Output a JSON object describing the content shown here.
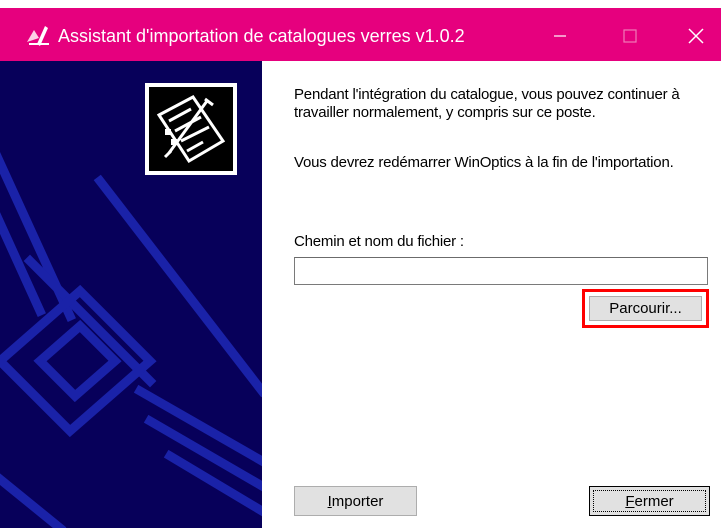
{
  "window": {
    "title": "Assistant d'importation de catalogues verres v1.0.2",
    "title_bar_color": "#e6007e",
    "controls": [
      "minimize-icon",
      "maximize-icon",
      "close-icon"
    ]
  },
  "sidebar": {
    "background_color": "#07005a",
    "emblem_icon": "document-pen-icon"
  },
  "content": {
    "paragraph1": "Pendant l'intégration du catalogue, vous pouvez continuer à travailler normalement, y compris sur ce poste.",
    "paragraph2": "Vous devrez redémarrer WinOptics à la fin de l'importation.",
    "file_label": "Chemin et nom du fichier :",
    "file_value": ""
  },
  "buttons": {
    "browse": "Parcourir...",
    "import_first": "I",
    "import_rest": "mporter",
    "close_first": "F",
    "close_rest": "ermer"
  },
  "highlight_color": "#ff0000"
}
